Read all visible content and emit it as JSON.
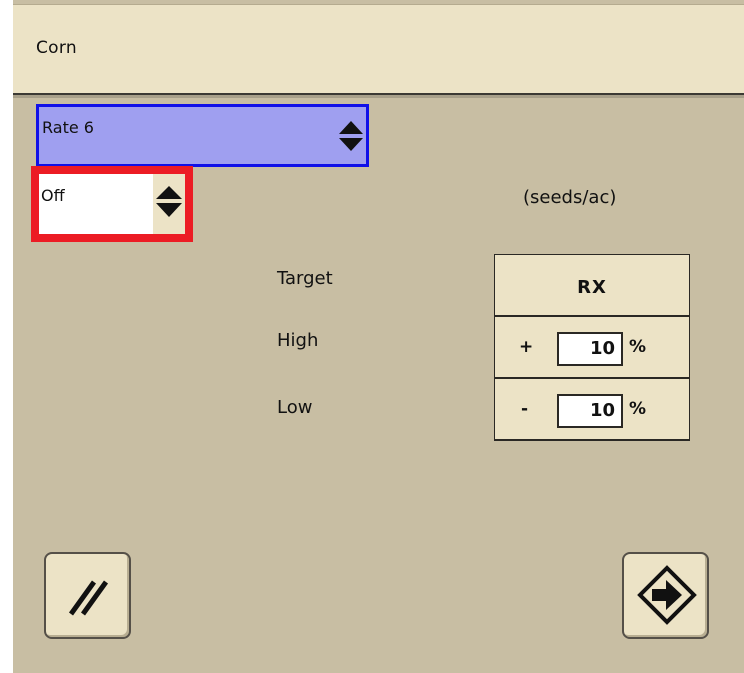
{
  "header": {
    "title": "Corn"
  },
  "rate_select": {
    "value": "Rate 6",
    "icon": "up-down-arrows-icon"
  },
  "mode_select": {
    "value": "Off",
    "icon": "up-down-arrows-icon"
  },
  "units": "(seeds/ac)",
  "rows": {
    "target_label": "Target",
    "high_label": "High",
    "low_label": "Low"
  },
  "rx_table": {
    "header": "RX",
    "high": {
      "sign": "+",
      "value": "10",
      "unit": "%"
    },
    "low": {
      "sign": "-",
      "value": "10",
      "unit": "%"
    }
  },
  "buttons": {
    "cancel_icon": "double-slash-icon",
    "next_icon": "arrow-right-diamond-icon"
  },
  "colors": {
    "background": "#c8bea3",
    "panel": "#ece3c6",
    "selected_border": "#1010e8",
    "selected_fill": "#9f9ff0",
    "focus_border": "#ec1c24"
  }
}
